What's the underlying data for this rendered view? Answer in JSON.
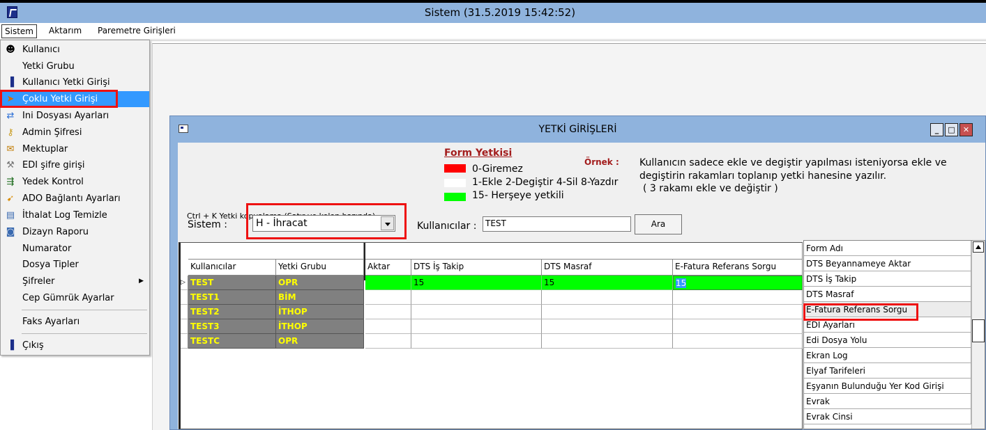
{
  "window": {
    "title": "Sistem (31.5.2019 15:42:52)"
  },
  "menubar": [
    "Sistem",
    "Aktarım",
    "Paremetre Girişleri"
  ],
  "sistem_menu": {
    "items": [
      {
        "label": "Kullanıcı",
        "icon": "user-face-icon"
      },
      {
        "label": "Yetki Grubu",
        "icon": ""
      },
      {
        "label": "Kullanıcı Yetki Girişi",
        "icon": "door-exit-icon"
      },
      {
        "label": "Çoklu Yetki Girişi",
        "icon": "arrow-cursor-icon",
        "selected": true
      },
      {
        "label": "Ini Dosyası  Ayarları",
        "icon": "settings-file-icon"
      },
      {
        "label": "Admin Şifresi",
        "icon": "key-icon"
      },
      {
        "label": "Mektuplar",
        "icon": "mail-arrow-icon"
      },
      {
        "label": "EDI şifre girişi",
        "icon": "tools-icon"
      },
      {
        "label": "Yedek Kontrol",
        "icon": "backup-icon"
      },
      {
        "label": "ADO Bağlantı Ayarları",
        "icon": "connection-icon"
      },
      {
        "label": "İthalat Log Temizle",
        "icon": "log-icon"
      },
      {
        "label": "Dizayn Raporu",
        "icon": "report-icon"
      },
      {
        "label": "Numarator",
        "icon": ""
      },
      {
        "label": "Dosya Tipler",
        "icon": ""
      },
      {
        "label": "Şifreler",
        "icon": "",
        "submenu": true
      },
      {
        "label": "Cep Gümrük Ayarlar",
        "icon": ""
      },
      {
        "label": "Faks Ayarları",
        "icon": ""
      },
      {
        "label": "Çıkış",
        "icon": "door-exit-icon"
      }
    ]
  },
  "dialog": {
    "title": "YETKİ GİRİŞLERİ",
    "hint": "Ctrl + K Yetki kopyalama (Satır ve kolon bazında)",
    "legend": {
      "title": "Form Yetkisi",
      "items": [
        {
          "color": "#ff0000",
          "text": "0-Giremez"
        },
        {
          "color": "#ffffff",
          "text": "1-Ekle  2-Degiştir  4-Sil  8-Yazdır"
        },
        {
          "color": "#00ff00",
          "text": "15- Herşeye yetkili"
        }
      ]
    },
    "example": {
      "label": "Örnek :",
      "lines": [
        "Kullanıcın sadece ekle ve degiştir yapılması isteniyorsa  ekle ve",
        "degiştirin rakamları toplanıp yetki hanesine yazılır.",
        "( 3 rakamı ekle ve değiştir )"
      ]
    },
    "sistem_label": "Sistem :",
    "sistem_value": "H - İhracat",
    "kullanicilar_label": "Kullanıcılar :",
    "kullanicilar_value": "TEST",
    "ara_label": "Ara",
    "grid": {
      "left_headers": [
        "Kullanıcılar",
        "Yetki Grubu"
      ],
      "right_headers": [
        "Aktar",
        "DTS İş Takip",
        "DTS Masraf",
        "E-Fatura Referans Sorgu"
      ],
      "rows": [
        {
          "user": "TEST",
          "group": "OPR",
          "values": [
            "",
            "15",
            "15",
            "15"
          ]
        },
        {
          "user": "TEST1",
          "group": "BİM",
          "values": [
            "",
            "",
            "",
            ""
          ]
        },
        {
          "user": "TEST2",
          "group": "İTHOP",
          "values": [
            "",
            "",
            "",
            ""
          ]
        },
        {
          "user": "TEST3",
          "group": "İTHOP",
          "values": [
            "",
            "",
            "",
            ""
          ]
        },
        {
          "user": "TESTC",
          "group": "OPR",
          "values": [
            "",
            "",
            "",
            ""
          ]
        }
      ]
    },
    "form_list": {
      "header": "Form Adı",
      "items": [
        "DTS Beyannameye Aktar",
        "DTS İş Takip",
        "DTS Masraf",
        "E-Fatura Referans Sorgu",
        "EDI Ayarları",
        "Edi Dosya Yolu",
        "Ekran Log",
        "Elyaf Tarifeleri",
        "Eşyanın Bulunduğu Yer Kod Girişi",
        "Evrak",
        "Evrak Cinsi"
      ]
    }
  }
}
